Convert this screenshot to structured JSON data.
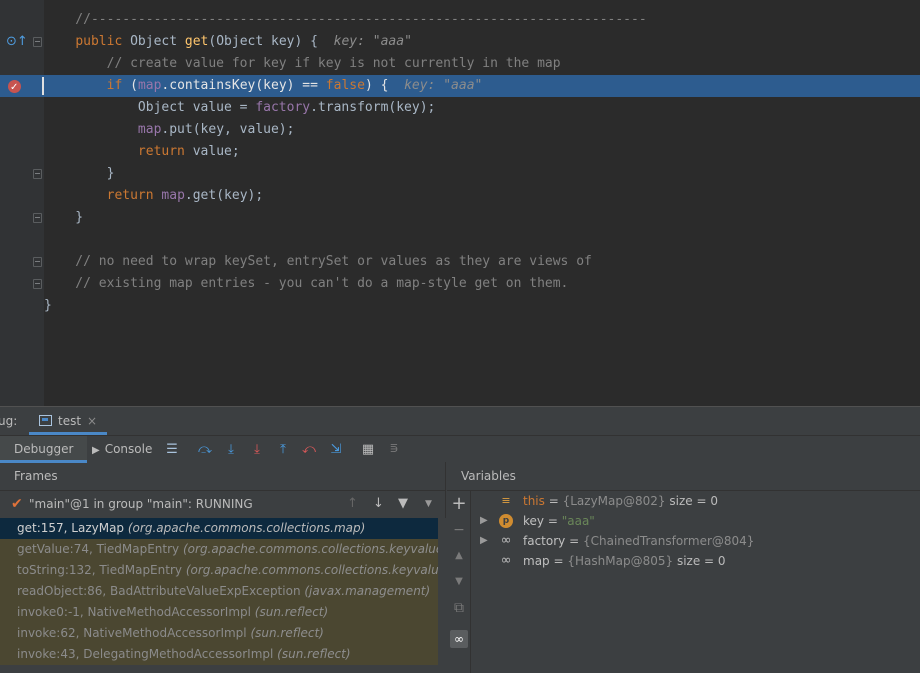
{
  "editor": {
    "lines": [
      {
        "text": "    //-----------------------------------------------------------------------"
      },
      {
        "text": "    public Object get(Object key) {",
        "hint": "key: \"aaa\""
      },
      {
        "text": "        // create value for key if key is not currently in the map"
      },
      {
        "text": "        if (map.containsKey(key) == false) {",
        "hint": "key: \"aaa\""
      },
      {
        "text": "            Object value = factory.transform(key);"
      },
      {
        "text": "            map.put(key, value);"
      },
      {
        "text": "            return value;"
      },
      {
        "text": "        }"
      },
      {
        "text": "        return map.get(key);"
      },
      {
        "text": "    }"
      },
      {
        "text": ""
      },
      {
        "text": "    // no need to wrap keySet, entrySet or values as they are views of"
      },
      {
        "text": "    // existing map entries - you can't do a map-style get on them."
      },
      {
        "text": "}"
      }
    ],
    "highlight_line_index": 3,
    "colors": {
      "keyword": "#cc7832",
      "method": "#ffc66d",
      "field": "#9876aa",
      "comment": "#808080",
      "highlight": "#2d5c8f"
    }
  },
  "debug": {
    "label": "ug:",
    "run_tab": "test",
    "toolbar": {
      "debugger_tab": "Debugger",
      "console_tab": "Console",
      "icons": [
        "frames-icon",
        "step-over-icon",
        "step-into-icon",
        "force-step-into-icon",
        "step-out-icon",
        "drop-frame-icon",
        "run-to-cursor-icon",
        "evaluate-icon",
        "trace-icon"
      ]
    },
    "frames": {
      "header": "Frames",
      "thread": "\"main\"@1 in group \"main\": RUNNING",
      "list": [
        {
          "method": "get:157, LazyMap",
          "package": "(org.apache.commons.collections.map)"
        },
        {
          "method": "getValue:74, TiedMapEntry",
          "package": "(org.apache.commons.collections.keyvalue)"
        },
        {
          "method": "toString:132, TiedMapEntry",
          "package": "(org.apache.commons.collections.keyvalue)"
        },
        {
          "method": "readObject:86, BadAttributeValueExpException",
          "package": "(javax.management)"
        },
        {
          "method": "invoke0:-1, NativeMethodAccessorImpl",
          "package": "(sun.reflect)"
        },
        {
          "method": "invoke:62, NativeMethodAccessorImpl",
          "package": "(sun.reflect)"
        },
        {
          "method": "invoke:43, DelegatingMethodAccessorImpl",
          "package": "(sun.reflect)"
        }
      ],
      "selected_index": 0
    },
    "variables": {
      "header": "Variables",
      "list": [
        {
          "name": "this",
          "value": "{LazyMap@802}",
          "meta": "size = 0",
          "icon": "fields-icon",
          "expandable": false
        },
        {
          "name": "key",
          "value": "\"aaa\"",
          "meta": "",
          "icon": "parameter-icon",
          "expandable": true
        },
        {
          "name": "factory",
          "value": "{ChainedTransformer@804}",
          "meta": "",
          "icon": "watch-icon",
          "expandable": true
        },
        {
          "name": "map",
          "value": "{HashMap@805}",
          "meta": "size = 0",
          "icon": "watch-icon",
          "expandable": false
        }
      ]
    }
  }
}
